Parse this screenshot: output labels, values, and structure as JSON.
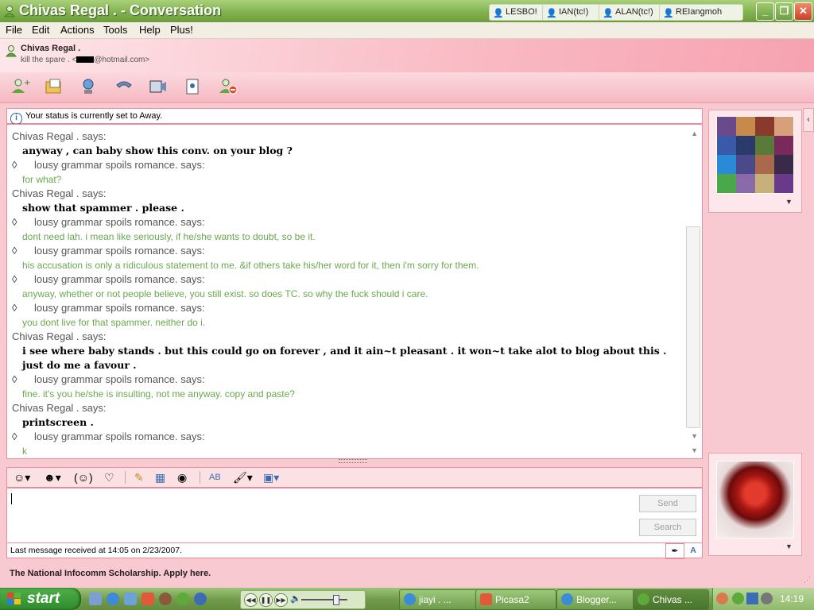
{
  "window": {
    "title": "Chivas Regal . - Conversation",
    "contact_tabs": [
      "LESBO!",
      "IAN(tc!)",
      "ALAN(tc!)",
      "REIangmoh"
    ],
    "controls": {
      "minimize": "_",
      "maximize": "❐",
      "close": "✕"
    }
  },
  "menu": [
    "File",
    "Edit",
    "Actions",
    "Tools",
    "Help",
    "Plus!"
  ],
  "contact_header": {
    "name": "Chivas Regal .",
    "subtitle_prefix": "kill the spare . <",
    "subtitle_suffix": "@hotmail.com>"
  },
  "toolbar_icons": [
    "invite-contact-icon",
    "send-files-icon",
    "webcam-icon",
    "call-icon",
    "video-icon",
    "activities-icon",
    "block-icon"
  ],
  "status_message": "Your status is currently set to Away.",
  "messages": [
    {
      "kind": "contact",
      "sender": "Chivas Regal . says:",
      "text": "anyway , can baby show this conv. on your blog ?"
    },
    {
      "kind": "self",
      "sender": "lousy grammar spoils romance. says:",
      "text": "for what?"
    },
    {
      "kind": "contact",
      "sender": "Chivas Regal . says:",
      "text": "show that spammer . please ."
    },
    {
      "kind": "self",
      "sender": "lousy grammar spoils romance. says:",
      "text": "dont need lah. i mean like seriously, if he/she wants to doubt, so be it."
    },
    {
      "kind": "self",
      "sender": "lousy grammar spoils romance. says:",
      "text": "his accusation is only a ridiculous statement to me. &if others take his/her word for it, then i'm sorry for them."
    },
    {
      "kind": "self",
      "sender": "lousy grammar spoils romance. says:",
      "text": "anyway, whether or not people believe, you still exist. so does TC. so why the fuck should i care."
    },
    {
      "kind": "self",
      "sender": "lousy grammar spoils romance. says:",
      "text": "you dont live for that spammer. neither do i."
    },
    {
      "kind": "contact",
      "sender": "Chivas Regal . says:",
      "text": "i see where baby stands . but this could go on forever , and it ain~t pleasant . it won~t take alot to blog about this . just do me a favour ."
    },
    {
      "kind": "self",
      "sender": "lousy grammar spoils romance. says:",
      "text": "fine. it's you he/she is insulting, not me anyway. copy and paste?"
    },
    {
      "kind": "contact",
      "sender": "Chivas Regal . says:",
      "text": "printscreen ."
    },
    {
      "kind": "self",
      "sender": "lousy grammar spoils romance. says:",
      "text": "k"
    }
  ],
  "self_marker": "◊",
  "compose": {
    "send_label": "Send",
    "search_label": "Search"
  },
  "last_message_status": "Last message received at 14:05 on 2/23/2007.",
  "ad_text": "The National Infocomm Scholarship. Apply here.",
  "taskbar": {
    "start_label": "start",
    "tasks": [
      {
        "label": "jiayi . ...",
        "icon": "ie-icon",
        "active": false
      },
      {
        "label": "Picasa2",
        "icon": "picasa-icon",
        "active": false
      },
      {
        "label": "Blogger...",
        "icon": "ie-icon",
        "active": false
      },
      {
        "label": "Chivas ...",
        "icon": "messenger-icon",
        "active": true
      }
    ],
    "clock": "14:19"
  },
  "colors": {
    "self_text": "#6aa84f",
    "accent_pink": "#f9c9d1",
    "title_green": "#7fb04c"
  }
}
